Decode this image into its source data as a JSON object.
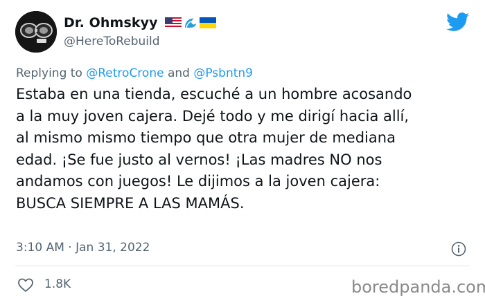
{
  "author": {
    "display_name": "Dr. Ohmskyy",
    "handle": "@HereToRebuild",
    "flags": [
      "us-flag-icon",
      "wave-icon",
      "ukraine-flag-icon"
    ]
  },
  "reply": {
    "prefix": "Replying to",
    "mention_1": "@RetroCrone",
    "connector": "and",
    "mention_2": "@Psbntn9"
  },
  "tweet": {
    "lines": [
      "Estaba en una tienda, escuché a un hombre acosando",
      "a la muy joven cajera. Dejé todo y me dirigí hacia allí,",
      "al mismo mismo tiempo que otra mujer de mediana",
      "edad. ¡Se fue justo al vernos! ¡Las madres NO nos",
      "andamos con juegos! Le dijimos a la joven cajera:",
      "BUSCA SIEMPRE A LAS MAMÁS."
    ]
  },
  "meta": {
    "time": "3:10 AM",
    "separator": "·",
    "date": "Jan 31, 2022"
  },
  "actions": {
    "like_count": "1.8K"
  },
  "watermark": "boredpanda.com",
  "colors": {
    "link": "#1d9bf0",
    "twitter_blue": "#1d9bf0",
    "secondary_text": "#536471",
    "text": "#0f1419"
  },
  "icons": {
    "avatar": "avatar",
    "logo": "twitter-bird-icon",
    "info": "info-icon",
    "like": "heart-icon"
  }
}
